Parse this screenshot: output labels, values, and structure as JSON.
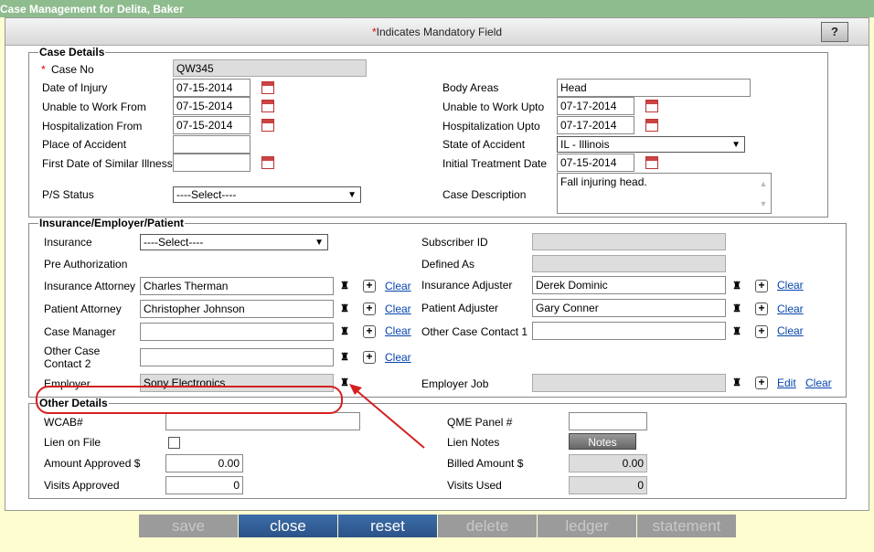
{
  "window": {
    "title": "Case Management for Delita, Baker"
  },
  "header": {
    "mandatory_star": "*",
    "mandatory_text": "Indicates Mandatory Field",
    "help_label": "?"
  },
  "case_details": {
    "legend": "Case Details",
    "case_no": {
      "star": "*",
      "label": "Case No",
      "value": "QW345"
    },
    "date_of_injury": {
      "label": "Date of Injury",
      "value": "07-15-2014"
    },
    "unable_from": {
      "label": "Unable to Work From",
      "value": "07-15-2014"
    },
    "hosp_from": {
      "label": "Hospitalization From",
      "value": "07-15-2014"
    },
    "place": {
      "label": "Place of Accident",
      "value": ""
    },
    "first_date": {
      "label": "First Date of Similar Illness",
      "value": ""
    },
    "ps_status": {
      "label": "P/S Status",
      "value": "----Select----"
    },
    "body_areas": {
      "label": "Body Areas",
      "value": "Head"
    },
    "unable_upto": {
      "label": "Unable to Work Upto",
      "value": "07-17-2014"
    },
    "hosp_upto": {
      "label": "Hospitalization Upto",
      "value": "07-17-2014"
    },
    "state": {
      "label": "State of Accident",
      "value": "IL - Illinois"
    },
    "initial_treatment": {
      "label": "Initial Treatment Date",
      "value": "07-15-2014"
    },
    "description": {
      "label": "Case Description",
      "value": "Fall injuring head."
    }
  },
  "iep": {
    "legend": "Insurance/Employer/Patient",
    "insurance": {
      "label": "Insurance",
      "value": "----Select----"
    },
    "pre_auth": {
      "label": "Pre Authorization"
    },
    "ins_attorney": {
      "label": "Insurance Attorney",
      "value": "Charles Therman"
    },
    "pat_attorney": {
      "label": "Patient Attorney",
      "value": "Christopher Johnson"
    },
    "case_manager": {
      "label": "Case Manager",
      "value": ""
    },
    "other_contact2": {
      "label1": "Other Case",
      "label2": "Contact 2",
      "value": ""
    },
    "employer": {
      "label": "Employer",
      "value": "Sony Electronics"
    },
    "subscriber": {
      "label": "Subscriber ID",
      "value": ""
    },
    "defined_as": {
      "label": "Defined As",
      "value": ""
    },
    "ins_adjuster": {
      "label": "Insurance Adjuster",
      "value": "Derek Dominic"
    },
    "pat_adjuster": {
      "label": "Patient Adjuster",
      "value": "Gary Conner"
    },
    "other_contact1": {
      "label": "Other Case Contact 1",
      "value": ""
    },
    "employer_job": {
      "label": "Employer Job",
      "value": ""
    },
    "clear_label": "Clear",
    "edit_label": "Edit",
    "plus": "+",
    "bino": "♜"
  },
  "other": {
    "legend": "Other Details",
    "wcab": {
      "label": "WCAB#",
      "value": ""
    },
    "lien": {
      "label": "Lien on File"
    },
    "amount_approved": {
      "label": "Amount Approved $",
      "value": "0.00"
    },
    "visits_approved": {
      "label": "Visits Approved",
      "value": "0"
    },
    "qme": {
      "label": "QME Panel #",
      "value": ""
    },
    "lien_notes": {
      "label": "Lien Notes",
      "button": "Notes"
    },
    "billed": {
      "label": "Billed Amount $",
      "value": "0.00"
    },
    "visits_used": {
      "label": "Visits Used",
      "value": "0"
    }
  },
  "toolbar": {
    "save": "save",
    "close": "close",
    "reset": "reset",
    "delete": "delete",
    "ledger": "ledger",
    "statement": "statement"
  },
  "colors": {
    "title_bar": "#8fbc8f",
    "active_button": "#2f5c96",
    "annotation": "#d42020"
  }
}
